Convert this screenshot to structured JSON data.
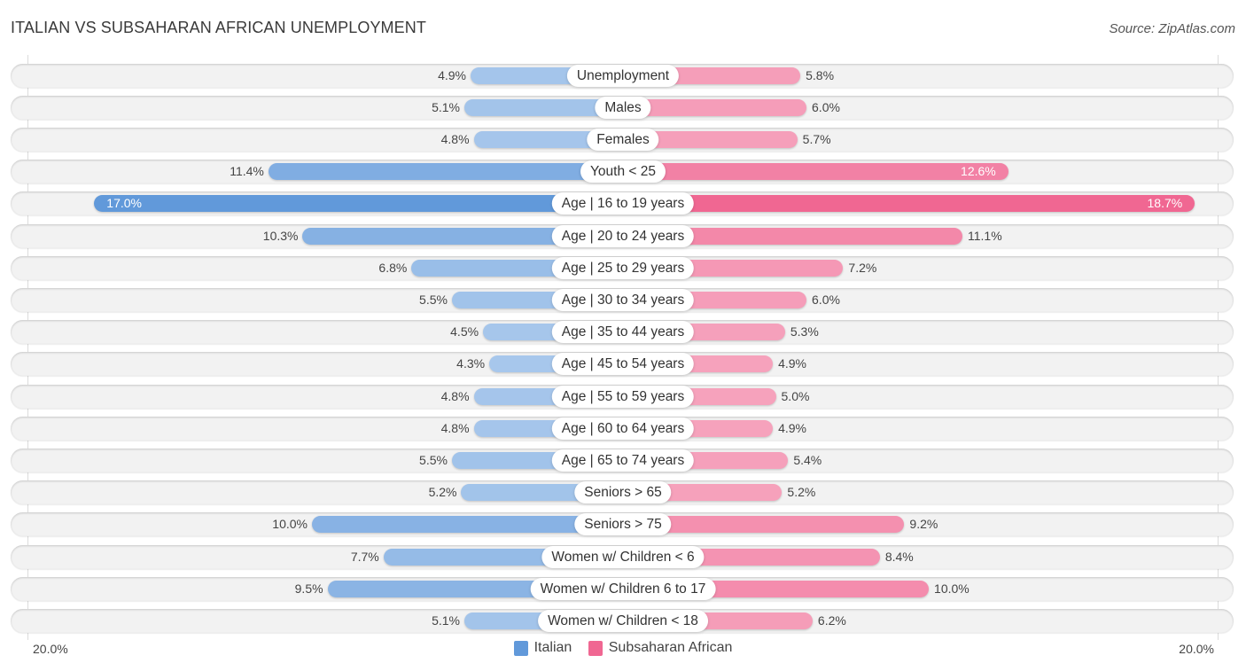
{
  "header": {
    "title": "ITALIAN VS SUBSAHARAN AFRICAN UNEMPLOYMENT",
    "source": "Source: ZipAtlas.com"
  },
  "colors": {
    "italian_light": "#a9c8ec",
    "italian_strong": "#6199da",
    "subsaharan_light": "#f6a6bf",
    "subsaharan_strong": "#f06792"
  },
  "chart_data": {
    "type": "bar",
    "orientation": "horizontal-diverging",
    "title": "ITALIAN VS SUBSAHARAN AFRICAN UNEMPLOYMENT",
    "xlabel": "",
    "ylabel": "",
    "axis_min_label": "20.0%",
    "axis_max_label": "20.0%",
    "xlim": [
      -20,
      20
    ],
    "legend_position": "bottom-center",
    "categories": [
      "Unemployment",
      "Males",
      "Females",
      "Youth < 25",
      "Age | 16 to 19 years",
      "Age | 20 to 24 years",
      "Age | 25 to 29 years",
      "Age | 30 to 34 years",
      "Age | 35 to 44 years",
      "Age | 45 to 54 years",
      "Age | 55 to 59 years",
      "Age | 60 to 64 years",
      "Age | 65 to 74 years",
      "Seniors > 65",
      "Seniors > 75",
      "Women w/ Children < 6",
      "Women w/ Children 6 to 17",
      "Women w/ Children < 18"
    ],
    "series": [
      {
        "name": "Italian",
        "side": "left",
        "values": [
          4.9,
          5.1,
          4.8,
          11.4,
          17.0,
          10.3,
          6.8,
          5.5,
          4.5,
          4.3,
          4.8,
          4.8,
          5.5,
          5.2,
          10.0,
          7.7,
          9.5,
          5.1
        ],
        "labels": [
          "4.9%",
          "5.1%",
          "4.8%",
          "11.4%",
          "17.0%",
          "10.3%",
          "6.8%",
          "5.5%",
          "4.5%",
          "4.3%",
          "4.8%",
          "4.8%",
          "5.5%",
          "5.2%",
          "10.0%",
          "7.7%",
          "9.5%",
          "5.1%"
        ]
      },
      {
        "name": "Subsaharan African",
        "side": "right",
        "values": [
          5.8,
          6.0,
          5.7,
          12.6,
          18.7,
          11.1,
          7.2,
          6.0,
          5.3,
          4.9,
          5.0,
          4.9,
          5.4,
          5.2,
          9.2,
          8.4,
          10.0,
          6.2
        ],
        "labels": [
          "5.8%",
          "6.0%",
          "5.7%",
          "12.6%",
          "18.7%",
          "11.1%",
          "7.2%",
          "6.0%",
          "5.3%",
          "4.9%",
          "5.0%",
          "4.9%",
          "5.4%",
          "5.2%",
          "9.2%",
          "8.4%",
          "10.0%",
          "6.2%"
        ]
      }
    ]
  },
  "legend": {
    "items": [
      {
        "label": "Italian"
      },
      {
        "label": "Subsaharan African"
      }
    ]
  }
}
